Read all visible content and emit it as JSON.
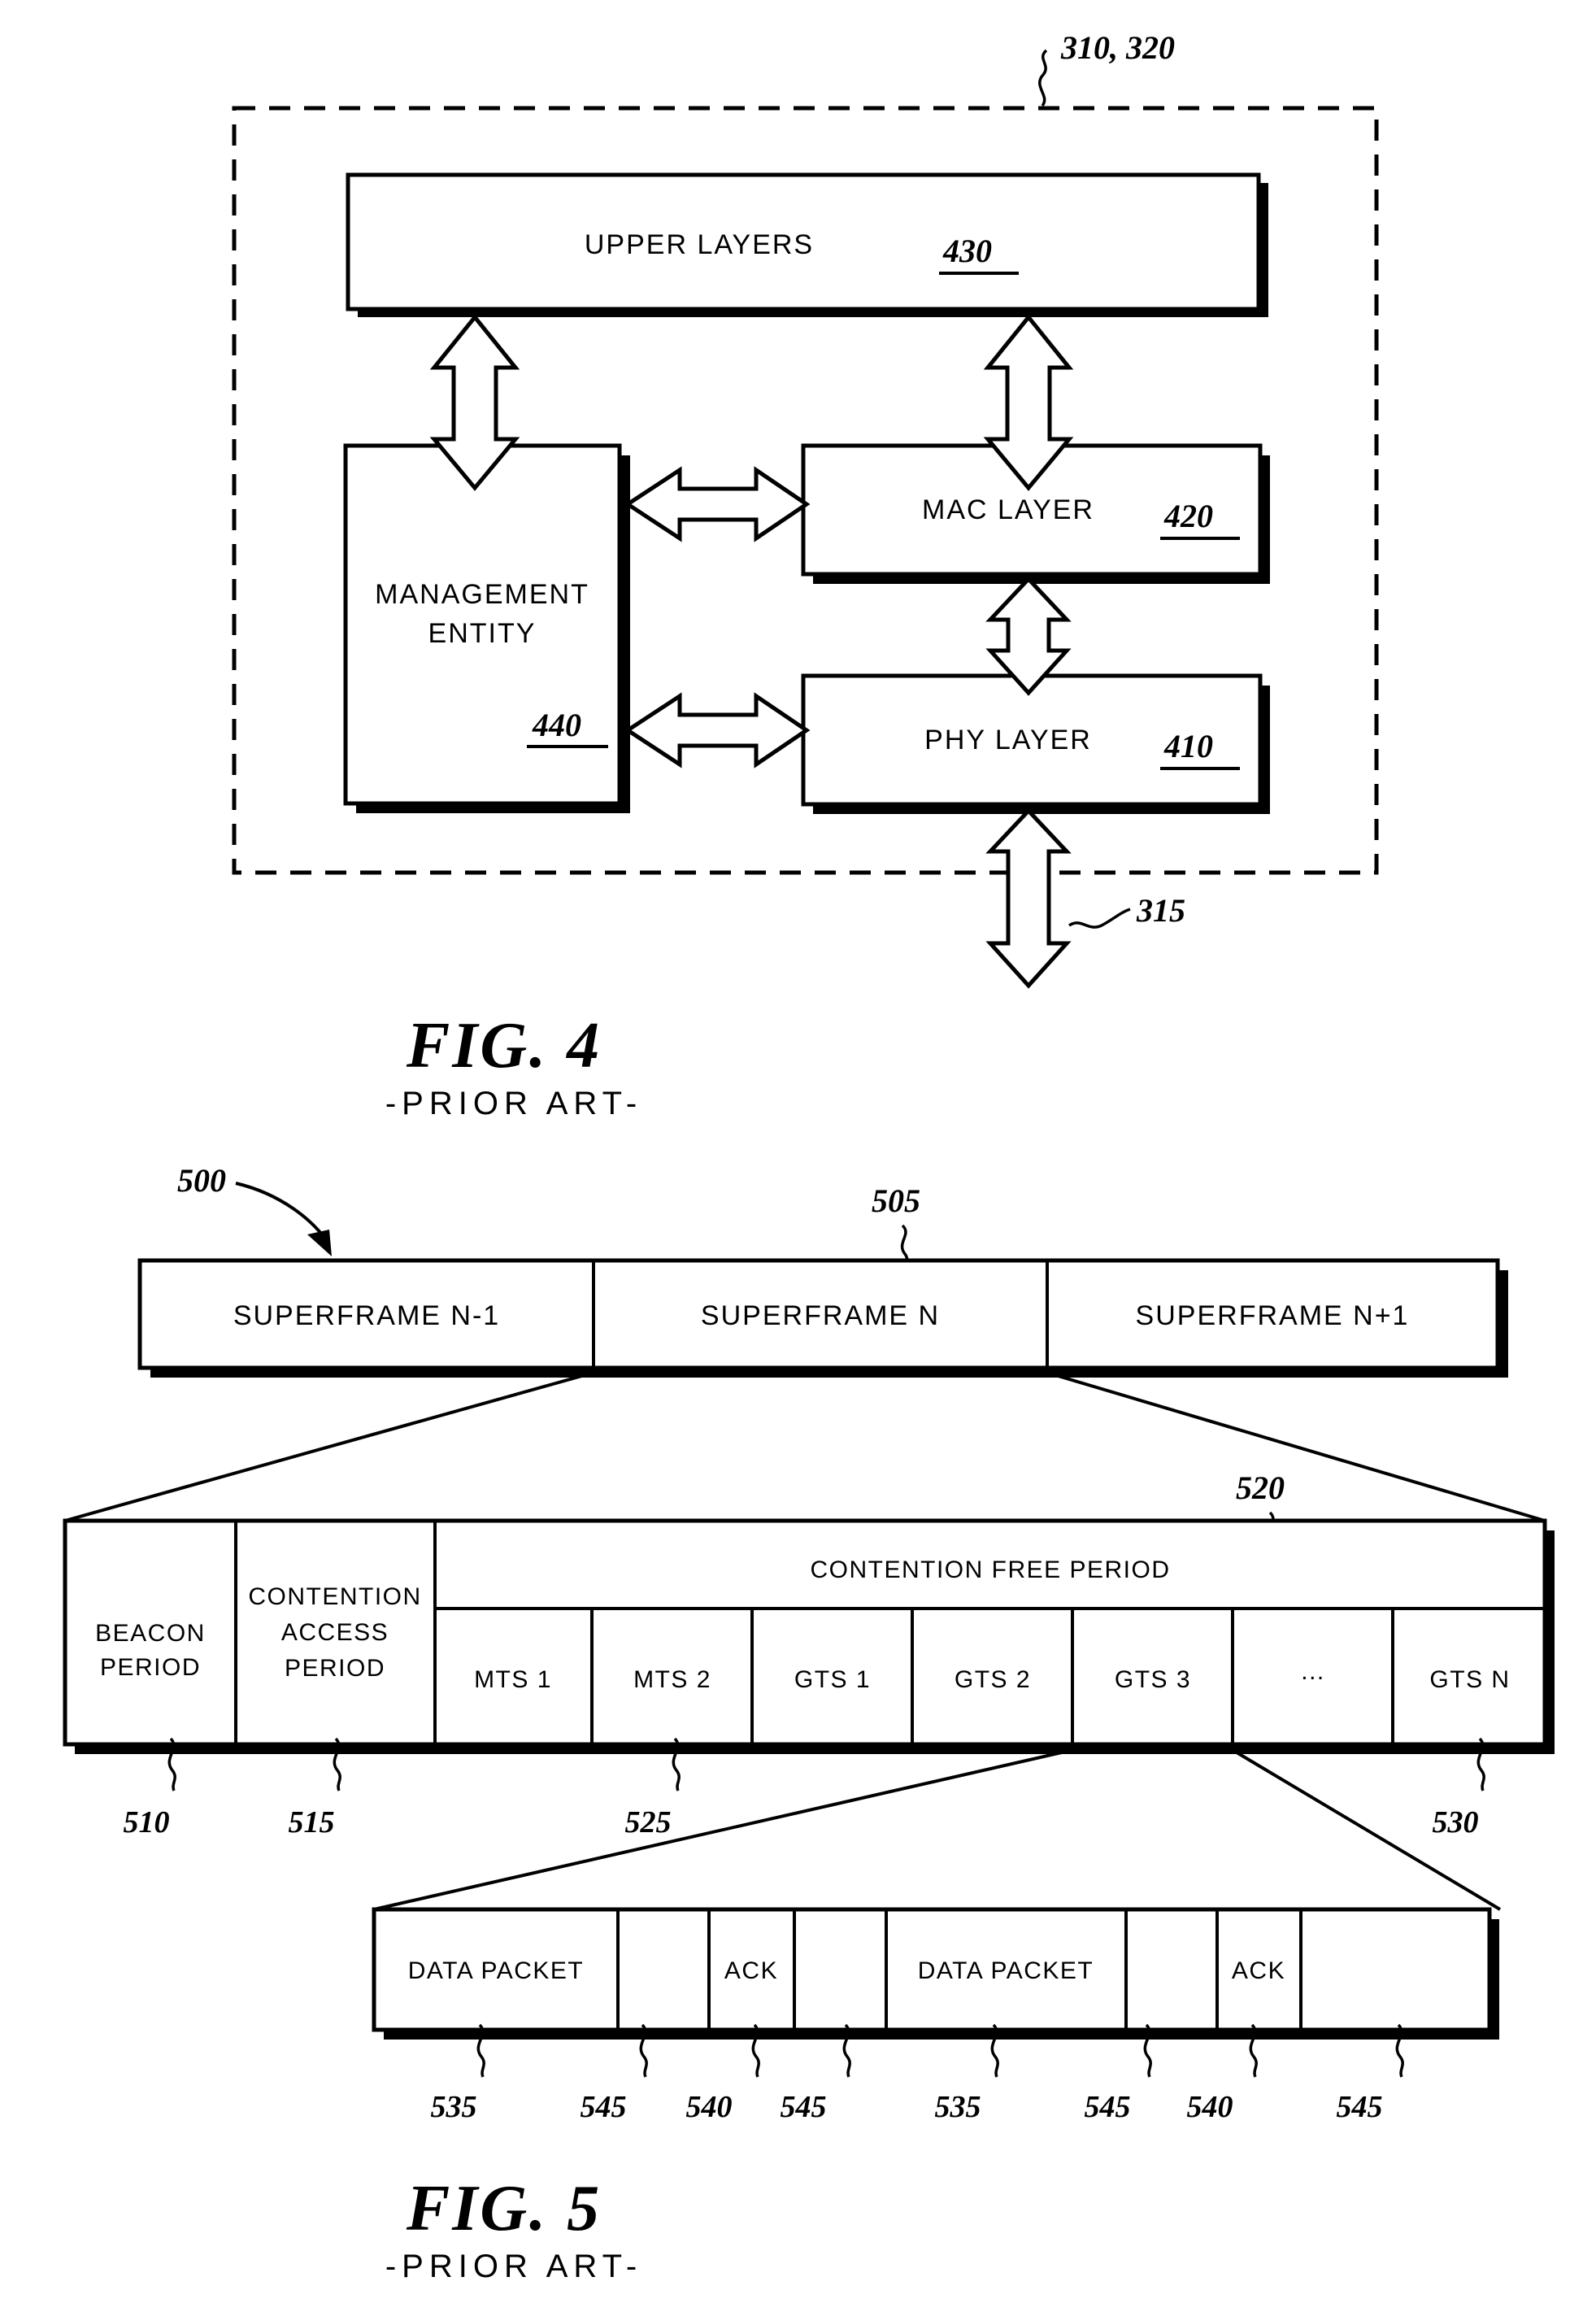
{
  "figure4": {
    "outer_ref": "310, 320",
    "boxes": [
      {
        "id": "upper-layers",
        "label": "UPPER LAYERS",
        "ref": "430"
      },
      {
        "id": "mac-layer",
        "label": "MAC LAYER",
        "ref": "420"
      },
      {
        "id": "phy-layer",
        "label": "PHY LAYER",
        "ref": "410"
      },
      {
        "id": "management-entity",
        "label_line1": "MANAGEMENT",
        "label_line2": "ENTITY",
        "ref": "440"
      }
    ],
    "external_ref": "315",
    "caption": "FIG. 4",
    "prior_art": "-PRIOR ART-"
  },
  "figure5": {
    "frame_ref": "500",
    "frame_boundary_ref": "505",
    "superframes": [
      {
        "label": "SUPERFRAME N-1"
      },
      {
        "label": "SUPERFRAME N"
      },
      {
        "label": "SUPERFRAME N+1"
      }
    ],
    "detail": {
      "beacon": {
        "line1": "BEACON",
        "line2": "PERIOD",
        "ref": "510"
      },
      "contention_access": {
        "line1": "CONTENTION",
        "line2": "ACCESS",
        "line3": "PERIOD",
        "ref": "515"
      },
      "contention_free_title": "CONTENTION FREE PERIOD",
      "contention_free_ref": "520",
      "slots": [
        {
          "label": "MTS 1"
        },
        {
          "label": "MTS 2"
        },
        {
          "label": "GTS 1"
        },
        {
          "label": "GTS 2"
        },
        {
          "label": "GTS 3"
        },
        {
          "label": "..."
        },
        {
          "label": "GTS N"
        }
      ],
      "slots_ref_left": "525",
      "slots_ref_right": "530"
    },
    "packets": {
      "cells": [
        {
          "label": "DATA PACKET",
          "ref": "535"
        },
        {
          "label": "",
          "ref": "545"
        },
        {
          "label": "ACK",
          "ref": "540"
        },
        {
          "label": "",
          "ref": "545"
        },
        {
          "label": "DATA PACKET",
          "ref": "535"
        },
        {
          "label": "",
          "ref": "545"
        },
        {
          "label": "ACK",
          "ref": "540"
        },
        {
          "label": "",
          "ref": "545"
        }
      ]
    },
    "caption": "FIG. 5",
    "prior_art": "-PRIOR ART-"
  }
}
